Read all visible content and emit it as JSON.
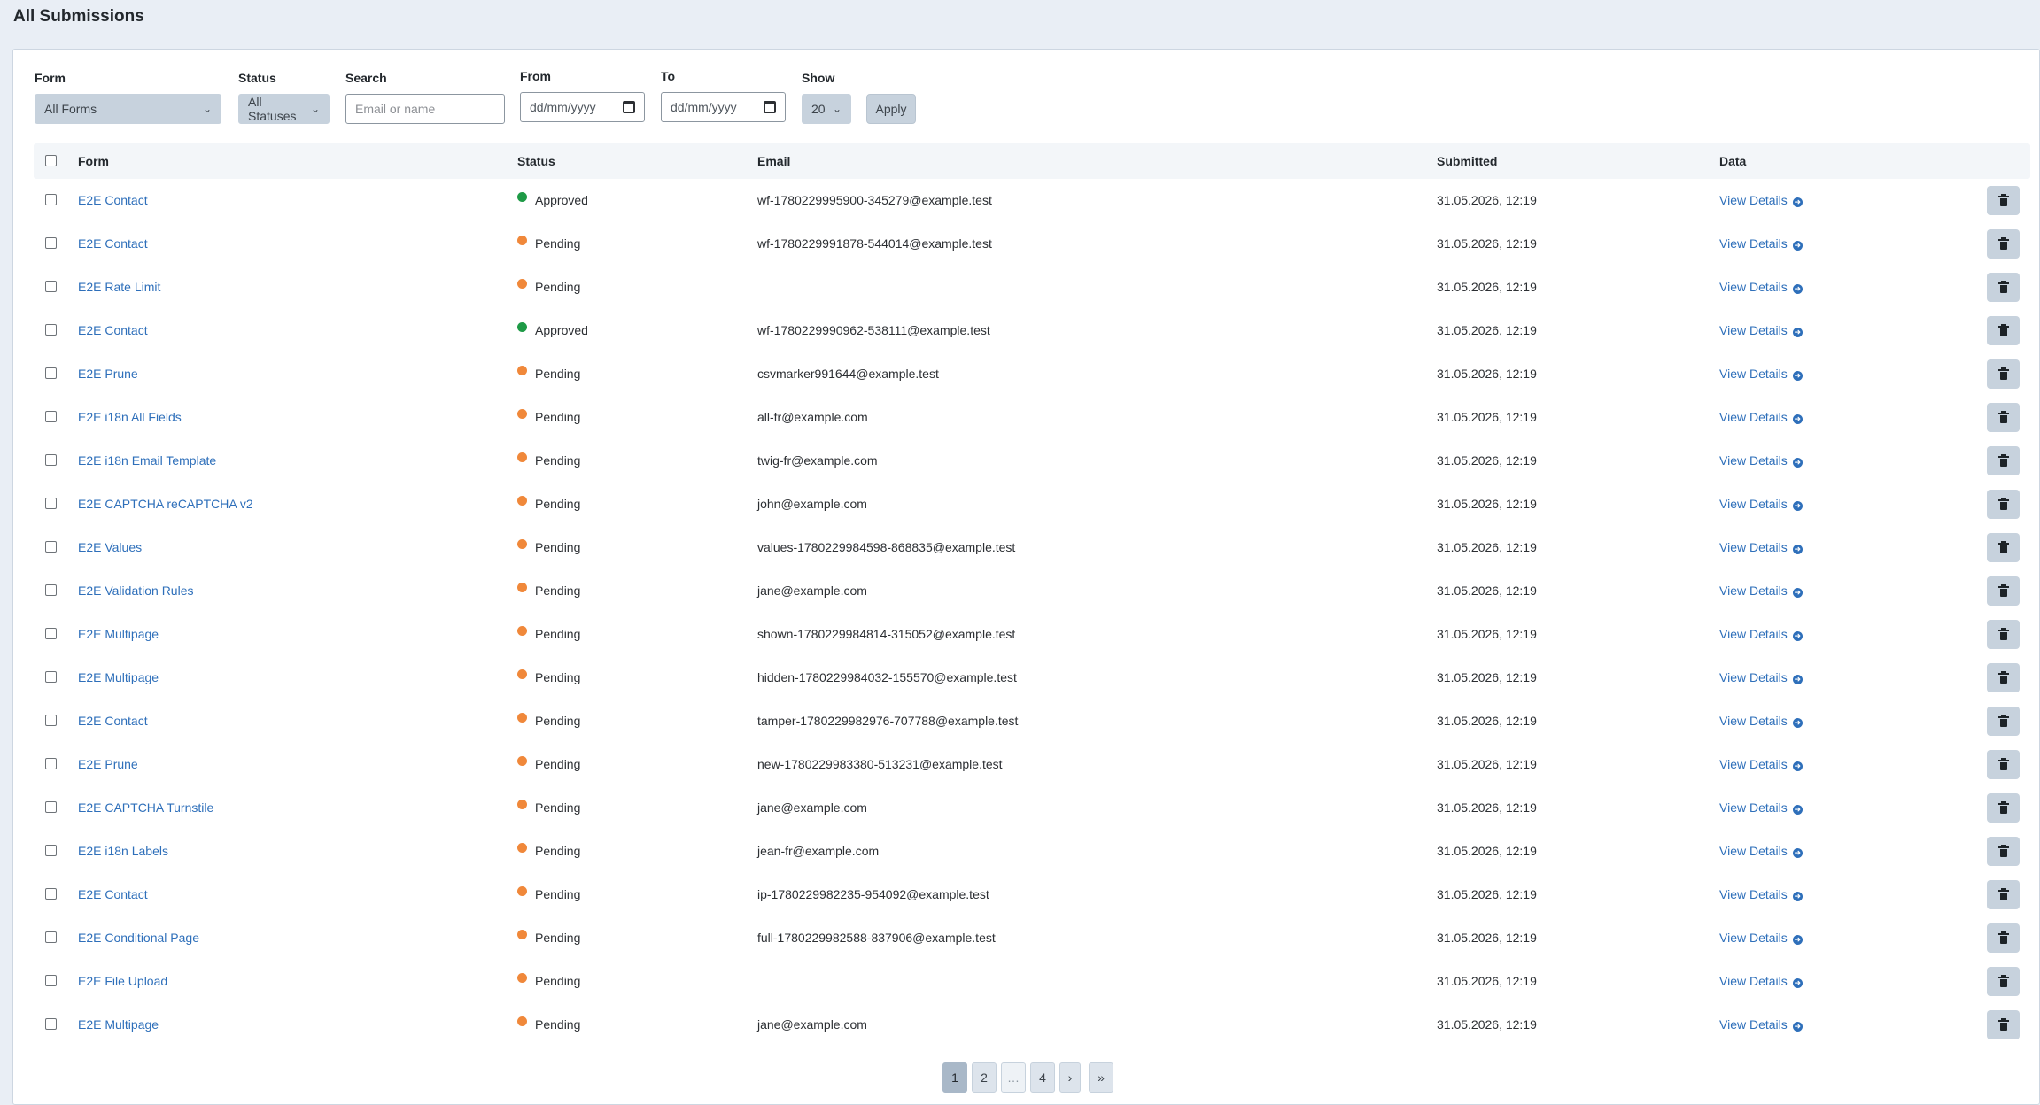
{
  "page": {
    "title": "All Submissions"
  },
  "filters": {
    "form_label": "Form",
    "form_value": "All Forms",
    "status_label": "Status",
    "status_value": "All Statuses",
    "search_label": "Search",
    "search_placeholder": "Email or name",
    "from_label": "From",
    "from_value": "dd/mm/yyyy",
    "to_label": "To",
    "to_value": "dd/mm/yyyy",
    "show_label": "Show",
    "show_value": "20",
    "apply_label": "Apply"
  },
  "table": {
    "headers": {
      "form": "Form",
      "status": "Status",
      "email": "Email",
      "submitted": "Submitted",
      "data": "Data"
    },
    "view_label": "View Details",
    "rows": [
      {
        "form": "E2E Contact",
        "status": "Approved",
        "email": "wf-1780229995900-345279@example.test",
        "submitted": "31.05.2026, 12:19"
      },
      {
        "form": "E2E Contact",
        "status": "Pending",
        "email": "wf-1780229991878-544014@example.test",
        "submitted": "31.05.2026, 12:19"
      },
      {
        "form": "E2E Rate Limit",
        "status": "Pending",
        "email": "",
        "submitted": "31.05.2026, 12:19"
      },
      {
        "form": "E2E Contact",
        "status": "Approved",
        "email": "wf-1780229990962-538111@example.test",
        "submitted": "31.05.2026, 12:19"
      },
      {
        "form": "E2E Prune",
        "status": "Pending",
        "email": "csvmarker991644@example.test",
        "submitted": "31.05.2026, 12:19"
      },
      {
        "form": "E2E i18n All Fields",
        "status": "Pending",
        "email": "all-fr@example.com",
        "submitted": "31.05.2026, 12:19"
      },
      {
        "form": "E2E i18n Email Template",
        "status": "Pending",
        "email": "twig-fr@example.com",
        "submitted": "31.05.2026, 12:19"
      },
      {
        "form": "E2E CAPTCHA reCAPTCHA v2",
        "status": "Pending",
        "email": "john@example.com",
        "submitted": "31.05.2026, 12:19"
      },
      {
        "form": "E2E Values",
        "status": "Pending",
        "email": "values-1780229984598-868835@example.test",
        "submitted": "31.05.2026, 12:19"
      },
      {
        "form": "E2E Validation Rules",
        "status": "Pending",
        "email": "jane@example.com",
        "submitted": "31.05.2026, 12:19"
      },
      {
        "form": "E2E Multipage",
        "status": "Pending",
        "email": "shown-1780229984814-315052@example.test",
        "submitted": "31.05.2026, 12:19"
      },
      {
        "form": "E2E Multipage",
        "status": "Pending",
        "email": "hidden-1780229984032-155570@example.test",
        "submitted": "31.05.2026, 12:19"
      },
      {
        "form": "E2E Contact",
        "status": "Pending",
        "email": "tamper-1780229982976-707788@example.test",
        "submitted": "31.05.2026, 12:19"
      },
      {
        "form": "E2E Prune",
        "status": "Pending",
        "email": "new-1780229983380-513231@example.test",
        "submitted": "31.05.2026, 12:19"
      },
      {
        "form": "E2E CAPTCHA Turnstile",
        "status": "Pending",
        "email": "jane@example.com",
        "submitted": "31.05.2026, 12:19"
      },
      {
        "form": "E2E i18n Labels",
        "status": "Pending",
        "email": "jean-fr@example.com",
        "submitted": "31.05.2026, 12:19"
      },
      {
        "form": "E2E Contact",
        "status": "Pending",
        "email": "ip-1780229982235-954092@example.test",
        "submitted": "31.05.2026, 12:19"
      },
      {
        "form": "E2E Conditional Page",
        "status": "Pending",
        "email": "full-1780229982588-837906@example.test",
        "submitted": "31.05.2026, 12:19"
      },
      {
        "form": "E2E File Upload",
        "status": "Pending",
        "email": "",
        "submitted": "31.05.2026, 12:19"
      },
      {
        "form": "E2E Multipage",
        "status": "Pending",
        "email": "jane@example.com",
        "submitted": "31.05.2026, 12:19"
      }
    ]
  },
  "pagination": {
    "pages": [
      "1",
      "2",
      "…",
      "4",
      "›",
      "»"
    ],
    "active": "1"
  },
  "colors": {
    "approved": "#1e9a46",
    "pending": "#f0883a",
    "link": "#2e6fba"
  },
  "icons": {
    "select_chevron": "chevron-down-icon",
    "date_picker": "calendar-icon",
    "view": "arrow-circle-right-icon",
    "delete": "trash-icon"
  }
}
